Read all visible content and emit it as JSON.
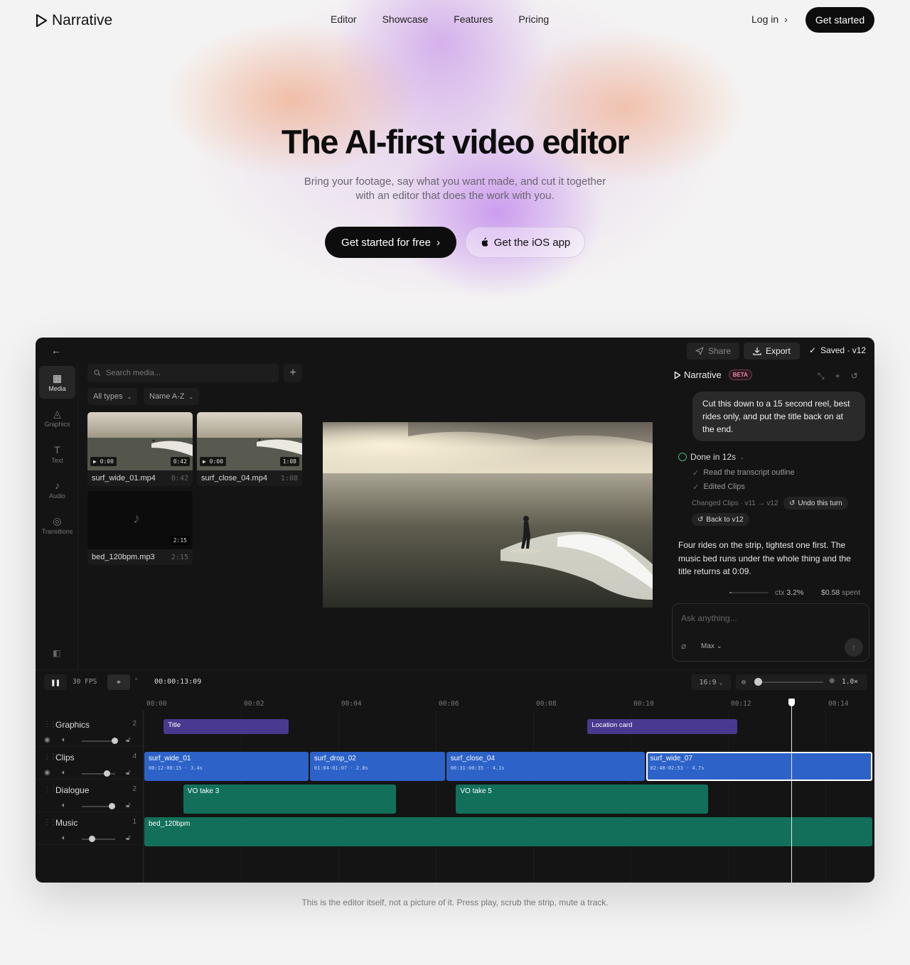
{
  "nav": {
    "brand": "Narrative",
    "links": [
      "Editor",
      "Showcase",
      "Features",
      "Pricing"
    ],
    "login": "Log in",
    "cta": "Get started"
  },
  "hero": {
    "title": "The AI-first video editor",
    "subtitle": "Bring your footage, say what you want made, and cut it together with an editor that does the work with you.",
    "primary_cta": "Get started for free",
    "secondary_cta": "Get the iOS app"
  },
  "caption": "This is the editor itself, not a picture of it. Press play, scrub the strip, mute a track.",
  "editor": {
    "topbar": {
      "share": "Share",
      "export": "Export",
      "saved": "Saved · v12"
    },
    "rail": [
      {
        "label": "Media",
        "icon": "film-icon",
        "active": true
      },
      {
        "label": "Graphics",
        "icon": "shapes-icon",
        "active": false
      },
      {
        "label": "Text",
        "icon": "text-icon",
        "active": false
      },
      {
        "label": "Audio",
        "icon": "music-note-icon",
        "active": false
      },
      {
        "label": "Transitions",
        "icon": "transitions-icon",
        "active": false
      }
    ],
    "media": {
      "search_placeholder": "Search media...",
      "filter_type": "All types",
      "filter_sort": "Name A-Z",
      "items": [
        {
          "name": "surf_wide_01.mp4",
          "start": "0:00",
          "duration": "0:42",
          "kind": "video"
        },
        {
          "name": "surf_close_04.mp4",
          "start": "0:00",
          "duration": "1:08",
          "kind": "video"
        },
        {
          "name": "bed_120bpm.mp3",
          "start": "",
          "duration": "2:15",
          "kind": "audio"
        }
      ]
    },
    "chat": {
      "brand": "Narrative",
      "badge": "BETA",
      "user_message": "Cut this down to a 15 second reel, best rides only, and put the title back on at the end.",
      "status": "Done in 12s",
      "steps": [
        "Read the transcript outline",
        "Edited Clips"
      ],
      "changed": "Changed Clips · v11 → v12",
      "undo": "Undo this turn",
      "back": "Back to v12",
      "reply": "Four rides on the strip, tightest one first. The music bed runs under the whole thing and the title returns at 0:09.",
      "ctx_label": "ctx",
      "ctx_value": "3.2%",
      "ctx_fraction": 0.032,
      "spent_value": "$0.58",
      "spent_label": "spent",
      "input_placeholder": "Ask anything...",
      "model": "Max"
    },
    "timeline": {
      "fps": "30 FPS",
      "timecode": "00:00:13:09",
      "aspect": "16:9",
      "zoom": "1.0×",
      "ruler": [
        "00:00",
        "00:02",
        "00:04",
        "00:06",
        "00:08",
        "00:10",
        "00:12",
        "00:14"
      ],
      "playhead_seconds": 13.3,
      "tracks": [
        {
          "name": "Graphics",
          "count": "2",
          "volume": null,
          "clips": [
            {
              "label": "Title",
              "start": 0.4,
              "end": 3.0,
              "color": "#4a3a8f"
            },
            {
              "label": "Location card",
              "start": 9.1,
              "end": 12.2,
              "color": "#4a3a8f"
            }
          ]
        },
        {
          "name": "Clips",
          "count": "4",
          "volume": 0.75,
          "clips": [
            {
              "label": "surf_wide_01",
              "sub": "00:12-00:15 · 3.4s",
              "start": 0,
              "end": 3.4,
              "color": "#2d63c8"
            },
            {
              "label": "surf_drop_02",
              "sub": "01:04-01:07 · 2.8s",
              "start": 3.4,
              "end": 6.2,
              "color": "#2d63c8"
            },
            {
              "label": "surf_close_04",
              "sub": "00:31-00:35 · 4.1s",
              "start": 6.2,
              "end": 10.3,
              "color": "#2d63c8"
            },
            {
              "label": "surf_wide_07",
              "sub": "02:48-02:53 · 4.7s",
              "start": 10.3,
              "end": 15.0,
              "color": "#2d63c8",
              "selected": true
            }
          ]
        },
        {
          "name": "Dialogue",
          "count": "2",
          "volume": 0.9,
          "clips": [
            {
              "label": "VO take 3",
              "start": 0.8,
              "end": 5.2,
              "color": "#12705a"
            },
            {
              "label": "VO take 5",
              "start": 6.4,
              "end": 11.6,
              "color": "#12705a"
            }
          ]
        },
        {
          "name": "Music",
          "count": "1",
          "volume": 0.3,
          "clips": [
            {
              "label": "bed_120bpm",
              "start": 0,
              "end": 15.0,
              "color": "#12705a"
            }
          ]
        }
      ]
    }
  }
}
